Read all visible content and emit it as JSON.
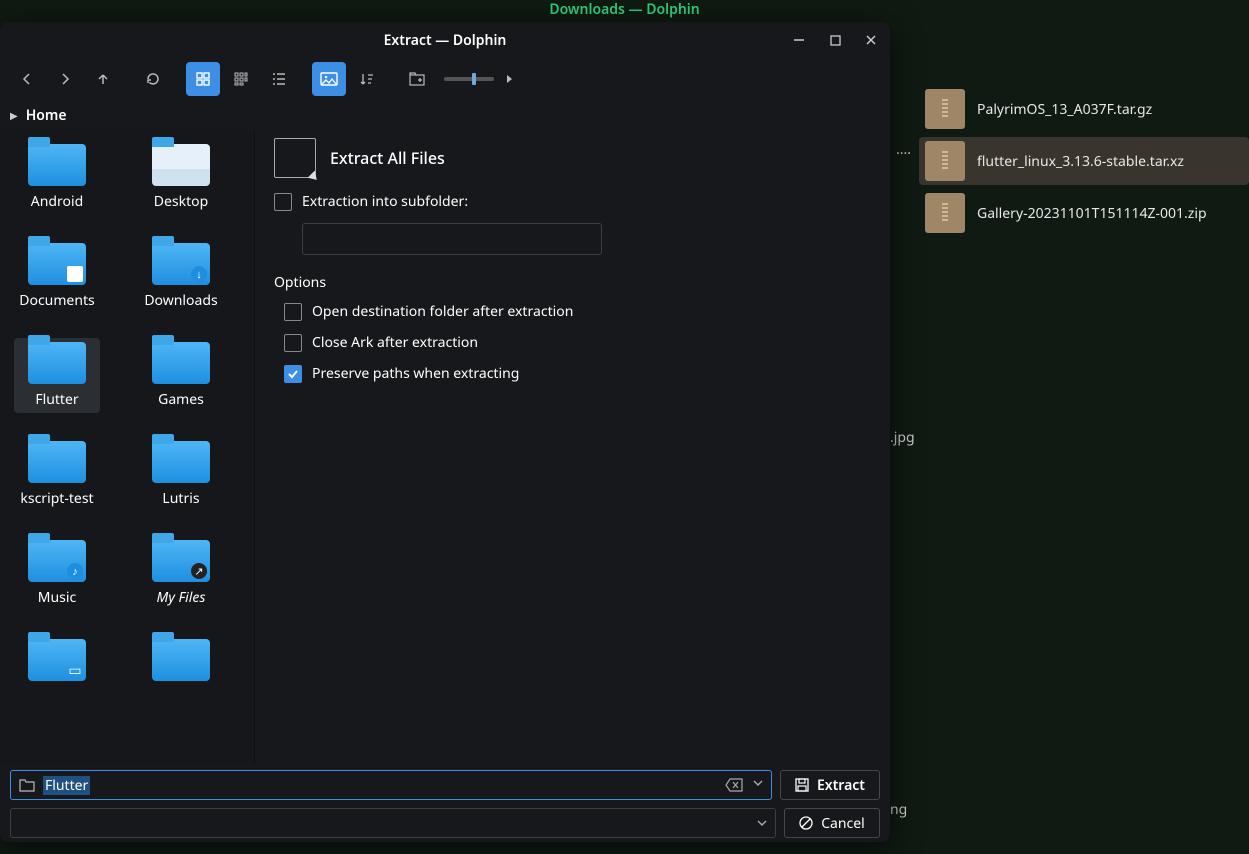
{
  "background": {
    "title": "Downloads — Dolphin",
    "files": [
      {
        "name": "PalyrimOS_13_A037F.tar.gz",
        "selected": false
      },
      {
        "name": "flutter_linux_3.13.6-stable.tar.xz",
        "selected": true
      },
      {
        "name": "Gallery-20231101T151114Z-001.zip",
        "selected": false
      }
    ],
    "stray1": "....",
    "stray2": ".jpg",
    "stray3": "ng"
  },
  "window": {
    "title": "Extract — Dolphin",
    "breadcrumb": "Home",
    "folders": [
      {
        "label": "Android",
        "variant": "plain"
      },
      {
        "label": "Desktop",
        "variant": "desktop"
      },
      {
        "label": "Documents",
        "variant": "doc"
      },
      {
        "label": "Downloads",
        "variant": "down"
      },
      {
        "label": "Flutter",
        "variant": "plain",
        "selected": true
      },
      {
        "label": "Games",
        "variant": "plain"
      },
      {
        "label": "kscript-test",
        "variant": "plain"
      },
      {
        "label": "Lutris",
        "variant": "plain"
      },
      {
        "label": "Music",
        "variant": "music"
      },
      {
        "label": "My Files",
        "variant": "link",
        "italic": true
      },
      {
        "label": "",
        "variant": "pic"
      },
      {
        "label": "",
        "variant": "plain"
      }
    ],
    "extract": {
      "heading": "Extract All Files",
      "subfolder_label": "Extraction into subfolder:",
      "subfolder_checked": false,
      "subfolder_value": "",
      "options_label": "Options",
      "opt_open": {
        "label": "Open destination folder after extraction",
        "checked": false
      },
      "opt_close": {
        "label": "Close Ark after extraction",
        "checked": false
      },
      "opt_preserve": {
        "label": "Preserve paths when extracting",
        "checked": true
      }
    },
    "bottom": {
      "name_value": "Flutter",
      "extract_label": "Extract",
      "cancel_label": "Cancel"
    }
  }
}
